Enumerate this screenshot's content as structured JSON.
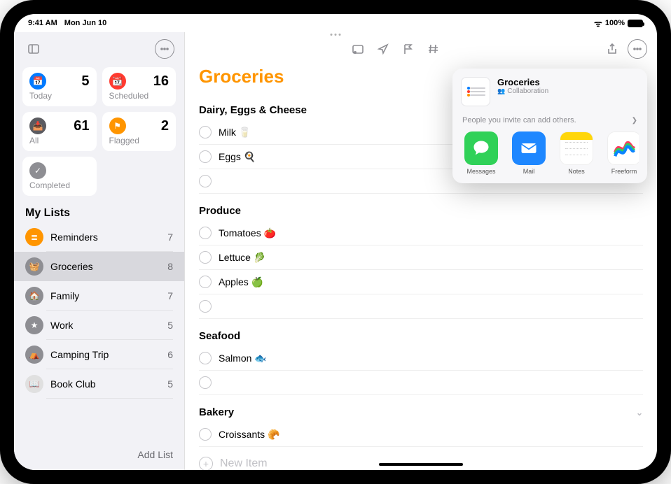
{
  "status": {
    "time": "9:41 AM",
    "date": "Mon Jun 10",
    "battery_pct": "100%"
  },
  "sidebar": {
    "cards": {
      "today": {
        "label": "Today",
        "count": "5"
      },
      "scheduled": {
        "label": "Scheduled",
        "count": "16"
      },
      "all": {
        "label": "All",
        "count": "61"
      },
      "flagged": {
        "label": "Flagged",
        "count": "2"
      },
      "completed": {
        "label": "Completed",
        "count": ""
      }
    },
    "my_lists_header": "My Lists",
    "lists": [
      {
        "icon": "list",
        "color": "#ff9500",
        "label": "Reminders",
        "count": "7"
      },
      {
        "icon": "basket",
        "color": "#8e8e93",
        "label": "Groceries",
        "count": "8"
      },
      {
        "icon": "home",
        "color": "#8e8e93",
        "label": "Family",
        "count": "7"
      },
      {
        "icon": "star",
        "color": "#8e8e93",
        "label": "Work",
        "count": "5"
      },
      {
        "icon": "tent",
        "color": "#8e8e93",
        "label": "Camping Trip",
        "count": "6"
      },
      {
        "icon": "book",
        "color": "#e0e0e0",
        "label": "Book Club",
        "count": "5"
      }
    ],
    "active_list_index": 1,
    "add_list": "Add List"
  },
  "content": {
    "title": "Groceries",
    "new_item": "New Item",
    "sections": [
      {
        "header": "Dairy, Eggs & Cheese",
        "items": [
          {
            "text": "Milk 🥛"
          },
          {
            "text": "Eggs 🍳"
          },
          {
            "text": ""
          }
        ]
      },
      {
        "header": "Produce",
        "items": [
          {
            "text": "Tomatoes 🍅"
          },
          {
            "text": "Lettuce 🥬"
          },
          {
            "text": "Apples 🍏"
          },
          {
            "text": ""
          }
        ]
      },
      {
        "header": "Seafood",
        "items": [
          {
            "text": "Salmon 🐟"
          },
          {
            "text": ""
          }
        ]
      },
      {
        "header": "Bakery",
        "collapsible": true,
        "items": [
          {
            "text": "Croissants 🥐"
          }
        ]
      }
    ]
  },
  "share_sheet": {
    "title": "Groceries",
    "subtitle": "Collaboration",
    "invite_text": "People you invite can add others.",
    "apps": [
      {
        "label": "Messages",
        "bg": "#30d158",
        "glyph": "bubble"
      },
      {
        "label": "Mail",
        "bg": "#1e87ff",
        "glyph": "envelope"
      },
      {
        "label": "Notes",
        "bg": "#ffffff",
        "glyph": "notes"
      },
      {
        "label": "Freeform",
        "bg": "#ffffff",
        "glyph": "freeform"
      }
    ]
  }
}
